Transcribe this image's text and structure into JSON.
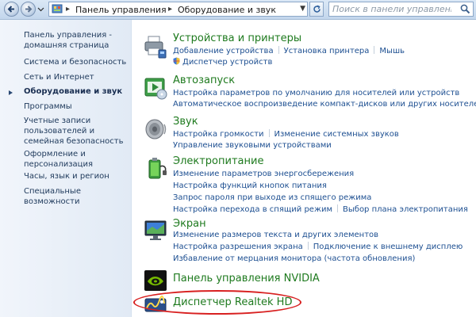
{
  "search": {
    "placeholder": "Поиск в панели управления"
  },
  "breadcrumb": {
    "items": [
      "Панель управления",
      "Оборудование и звук"
    ]
  },
  "sidebar": {
    "items": [
      {
        "label": "Панель управления - домашняя страница"
      },
      {
        "label": "Система и безопасность"
      },
      {
        "label": "Сеть и Интернет"
      },
      {
        "label": "Оборудование и звук",
        "active": true
      },
      {
        "label": "Программы"
      },
      {
        "label": "Учетные записи пользователей и семейная безопасность"
      },
      {
        "label": "Оформление и персонализация"
      },
      {
        "label": "Часы, язык и регион"
      },
      {
        "label": "Специальные возможности"
      }
    ]
  },
  "categories": [
    {
      "title": "Устройства и принтеры",
      "icon": "printer-icon",
      "rows": [
        [
          "Добавление устройства",
          "Установка принтера",
          "Мышь"
        ],
        [
          "Диспетчер устройств"
        ]
      ]
    },
    {
      "title": "Автозапуск",
      "icon": "autoplay-icon",
      "rows": [
        [
          "Настройка параметров по умолчанию для носителей или устройств"
        ],
        [
          "Автоматическое воспроизведение компакт-дисков или других носителей"
        ]
      ]
    },
    {
      "title": "Звук",
      "icon": "speaker-icon",
      "rows": [
        [
          "Настройка громкости",
          "Изменение системных звуков"
        ],
        [
          "Управление звуковыми устройствами"
        ]
      ]
    },
    {
      "title": "Электропитание",
      "icon": "power-battery-icon",
      "rows": [
        [
          "Изменение параметров энергосбережения"
        ],
        [
          "Настройка функций кнопок питания"
        ],
        [
          "Запрос пароля при выходе из спящего режима"
        ],
        [
          "Настройка перехода в спящий режим",
          "Выбор плана электропитания"
        ]
      ]
    },
    {
      "title": "Экран",
      "icon": "display-icon",
      "rows": [
        [
          "Изменение размеров текста и других элементов"
        ],
        [
          "Настройка разрешения экрана",
          "Подключение к внешнему дисплею"
        ],
        [
          "Избавление от мерцания монитора (частота обновления)"
        ]
      ]
    },
    {
      "title": "Панель управления NVIDIA",
      "icon": "nvidia-icon",
      "rows": []
    },
    {
      "title": "Диспетчер Realtek HD",
      "icon": "realtek-icon",
      "rows": []
    }
  ],
  "colors": {
    "category_title": "#1e7a1e",
    "task_link": "#1d4f91",
    "highlight": "#d82020"
  }
}
